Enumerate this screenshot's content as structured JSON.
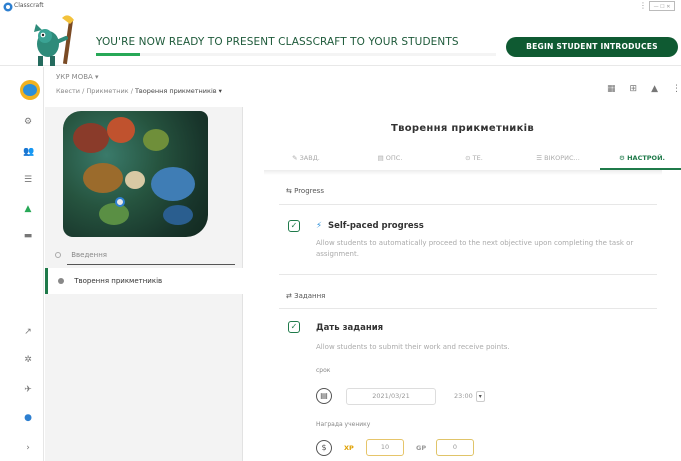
{
  "window": {
    "app_title": "Classcraft",
    "controls": [
      "⋮",
      "—",
      "☐",
      "✕"
    ]
  },
  "banner": {
    "message": "YOU'RE NOW READY TO PRESENT CLASSCRAFT TO YOUR STUDENTS",
    "progress": 0.11,
    "cta_label": "BEGIN STUDENT INTRODUCES"
  },
  "rail": {
    "icons": [
      "globe-avatar",
      "settings-icon",
      "people-icon",
      "tasks-icon",
      "tree-icon",
      "chat-icon",
      "chart-icon",
      "gear-icon",
      "rocket-icon",
      "help-icon",
      "expand-icon"
    ]
  },
  "header": {
    "class_name": "УКР МОВА ▾",
    "breadcrumb_root": "Квести",
    "breadcrumb_mid": "Прикметник",
    "breadcrumb_current": "Творення прикметників ▾",
    "icons": [
      "calendar-icon",
      "gift-icon",
      "bell-icon"
    ]
  },
  "objectives": [
    {
      "label": "Введення"
    },
    {
      "label": "Творення прикметників"
    }
  ],
  "main": {
    "title": "Творення прикметників",
    "tabs": [
      {
        "label": "✎ ЗАВД."
      },
      {
        "label": "▤ ОПС."
      },
      {
        "label": "⊙ ТЕ."
      },
      {
        "label": "☰ ВІКОРИС..."
      },
      {
        "label": "⚙ НАСТРОЙ."
      }
    ],
    "progress_section": "⇆ Progress",
    "self_paced": {
      "title": "Self-paced progress",
      "description": "Allow students to automatically proceed to the next objective upon completing the task or assignment."
    },
    "tasks_section": "⇄ Задання",
    "assignment": {
      "title": "Дать задания",
      "description": "Allow students to submit their work and receive points."
    },
    "due_label": "срок",
    "due_date": "2021/03/21",
    "due_time": "23:00",
    "reward_label": "Награда ученику",
    "xp_label": "XP",
    "xp_value": "10",
    "gp_label": "GP",
    "gp_value": "0"
  }
}
